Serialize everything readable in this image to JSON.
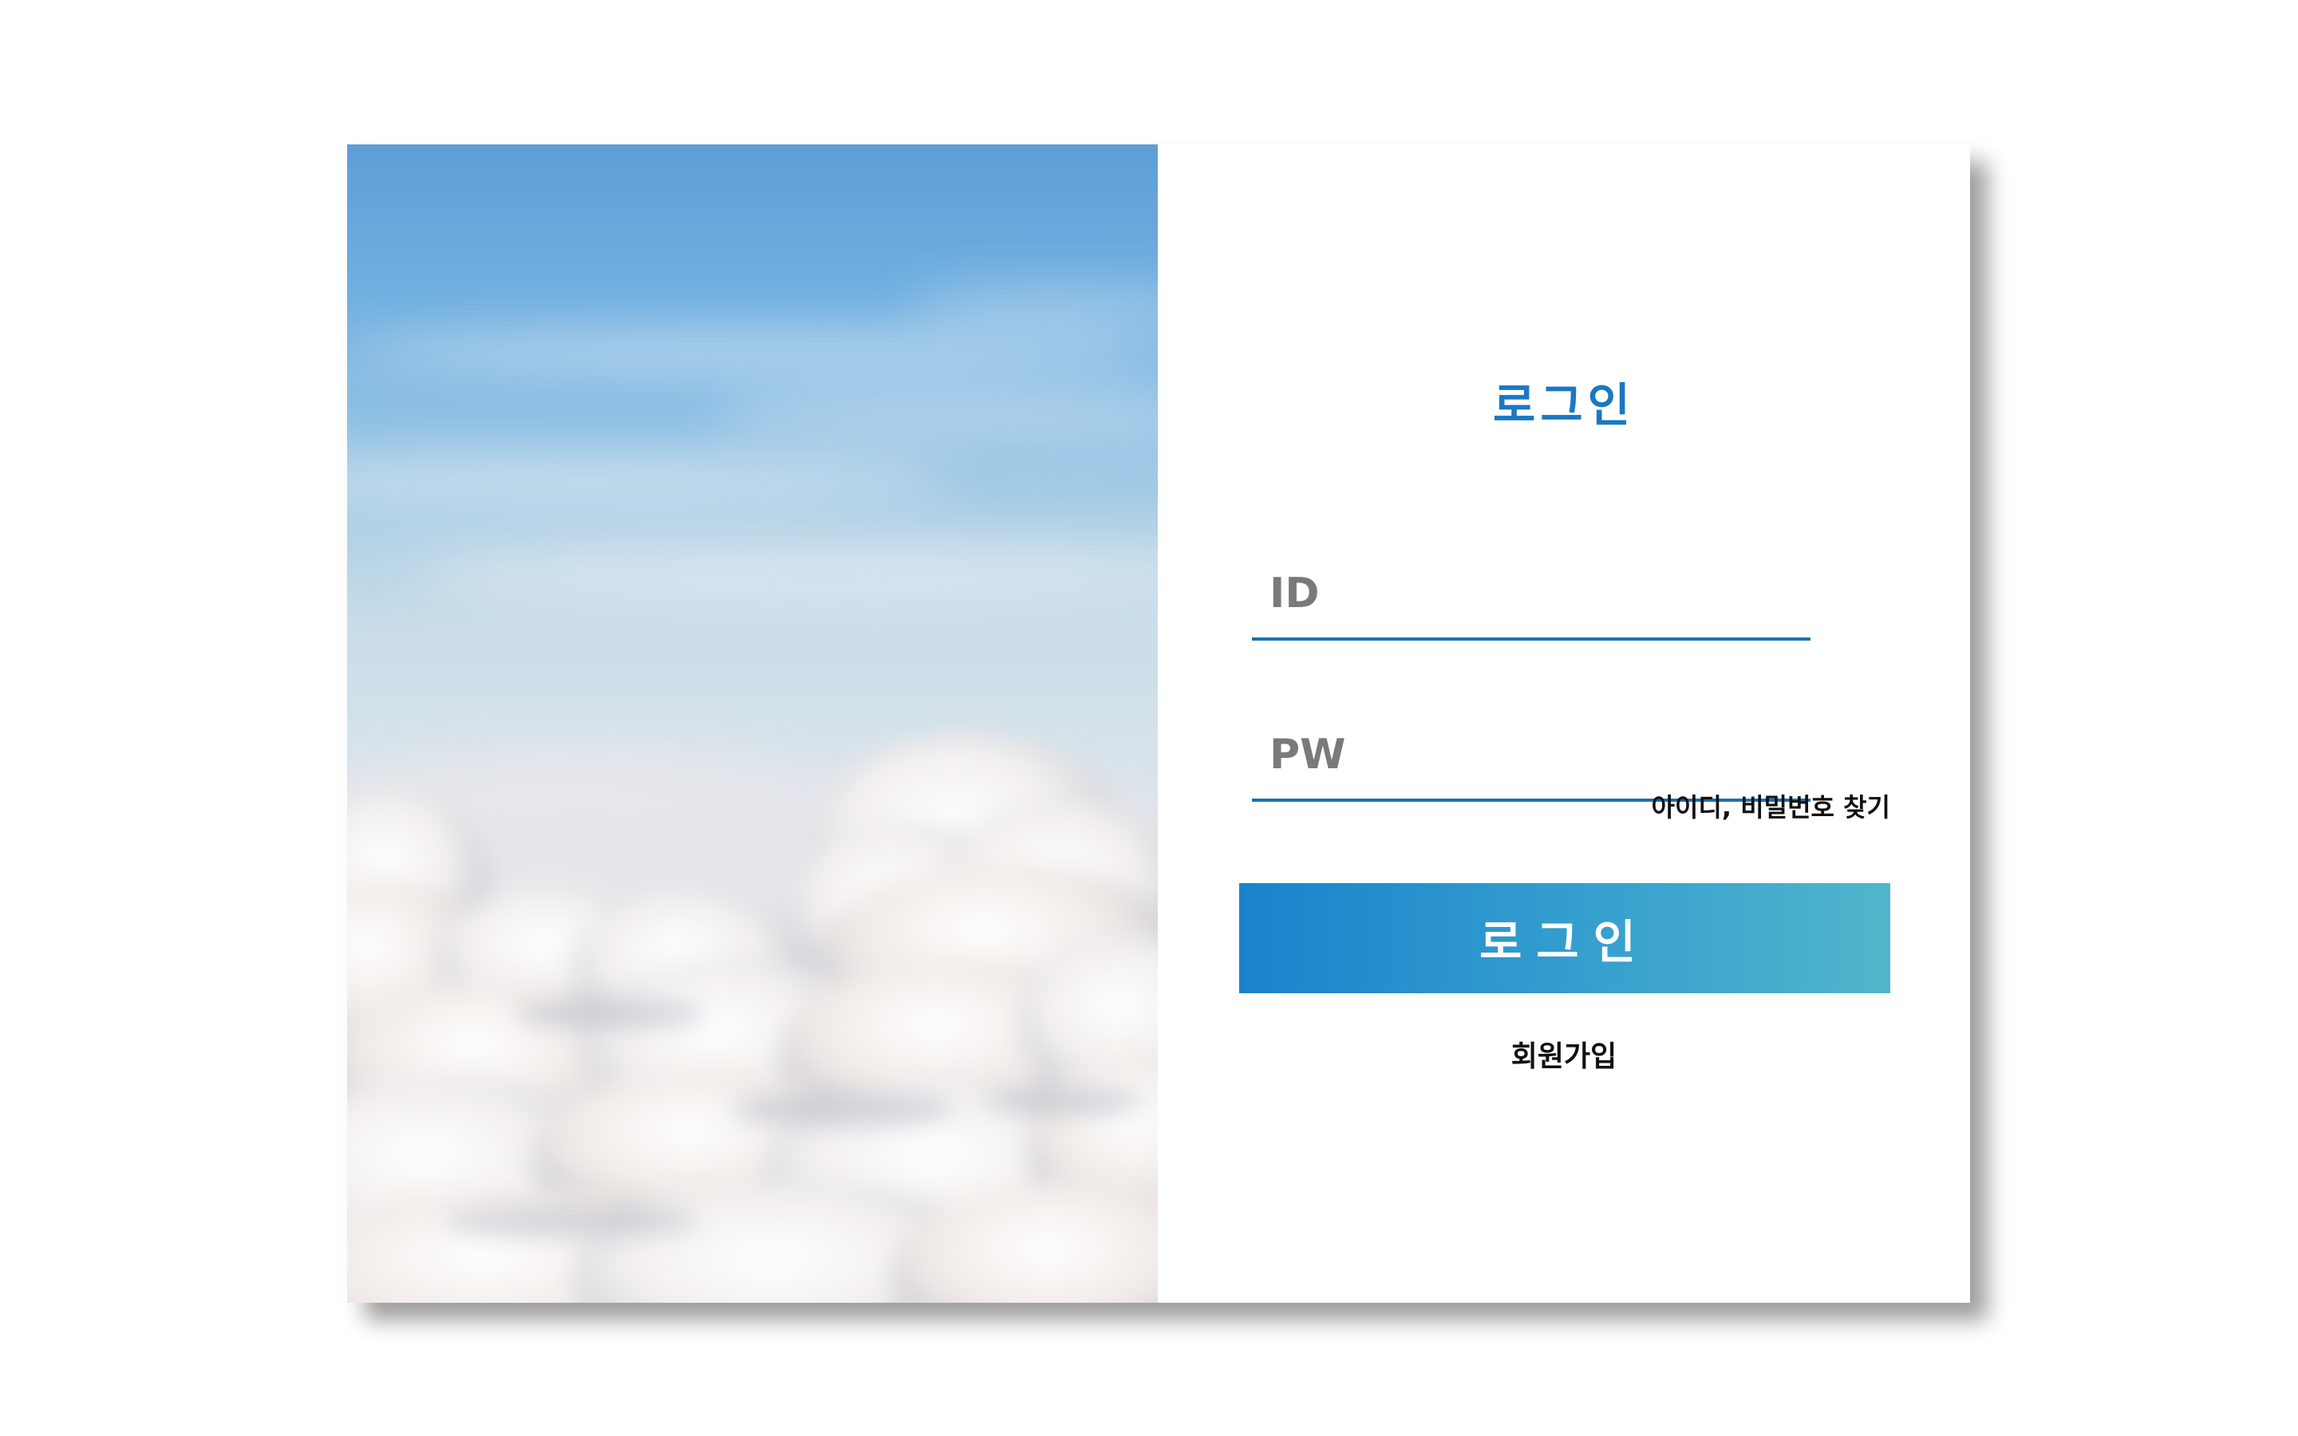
{
  "login_panel": {
    "title": "로그인",
    "id_placeholder": "ID",
    "pw_placeholder": "PW",
    "find_account_label": "아이디, 비밀번호 찾기",
    "login_button_label": "로그인",
    "signup_label": "회원가입"
  },
  "colors": {
    "accent": "#1a78c2",
    "button_gradient_start": "#1a82cc",
    "button_gradient_end": "#52b5cb"
  }
}
